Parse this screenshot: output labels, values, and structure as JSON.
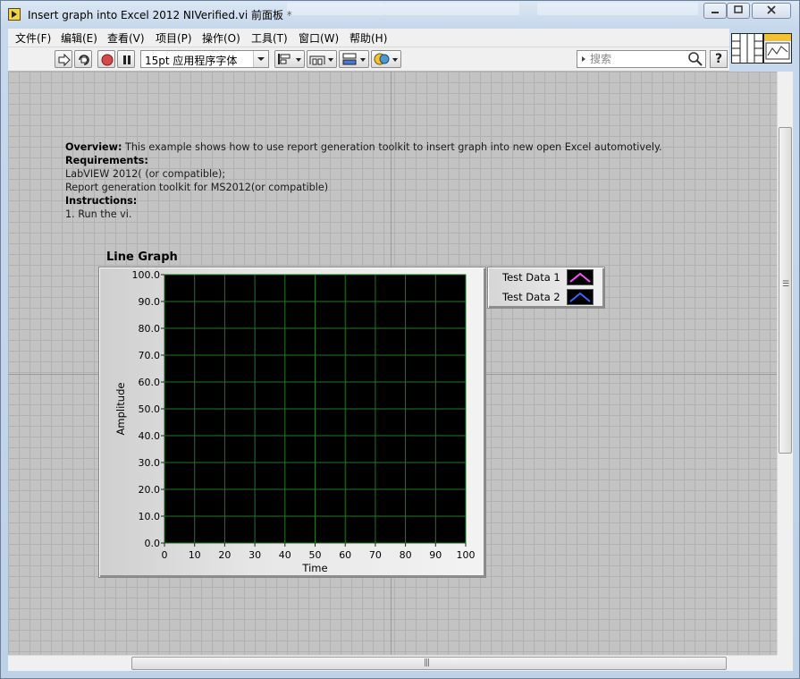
{
  "window": {
    "title": "Insert graph into Excel 2012 NIVerified.vi 前面板 *"
  },
  "menu": {
    "items": [
      "文件(F)",
      "编辑(E)",
      "查看(V)",
      "项目(P)",
      "操作(O)",
      "工具(T)",
      "窗口(W)",
      "帮助(H)"
    ]
  },
  "toolbar": {
    "font": "15pt 应用程序字体",
    "search_placeholder": "搜索",
    "help_label": "?"
  },
  "description": {
    "overview_label": "Overview:",
    "overview_text": " This example shows how to use report generation toolkit to insert graph into new open Excel automotively.",
    "requirements_label": "Requirements:",
    "req_line1": "LabVIEW 2012( (or compatible);",
    "req_line2": "Report generation toolkit for MS2012(or compatible)",
    "instructions_label": "Instructions:",
    "instr_line1": "1. Run the vi."
  },
  "chart_data": {
    "type": "line",
    "title": "Line Graph",
    "xlabel": "Time",
    "ylabel": "Amplitude",
    "xlim": [
      0,
      100
    ],
    "ylim": [
      0,
      100
    ],
    "x_ticks": [
      "0",
      "10",
      "20",
      "30",
      "40",
      "50",
      "60",
      "70",
      "80",
      "90",
      "100"
    ],
    "y_ticks": [
      "100.0",
      "90.0",
      "80.0",
      "70.0",
      "60.0",
      "50.0",
      "40.0",
      "30.0",
      "20.0",
      "10.0",
      "0.0"
    ],
    "grid": true,
    "legend_position": "right",
    "plot_background": "#000000",
    "grid_color": "#1e7a1e",
    "series": [
      {
        "name": "Test Data 1",
        "color": "#ff50ff",
        "values": []
      },
      {
        "name": "Test Data 2",
        "color": "#3a66ff",
        "values": []
      }
    ]
  }
}
